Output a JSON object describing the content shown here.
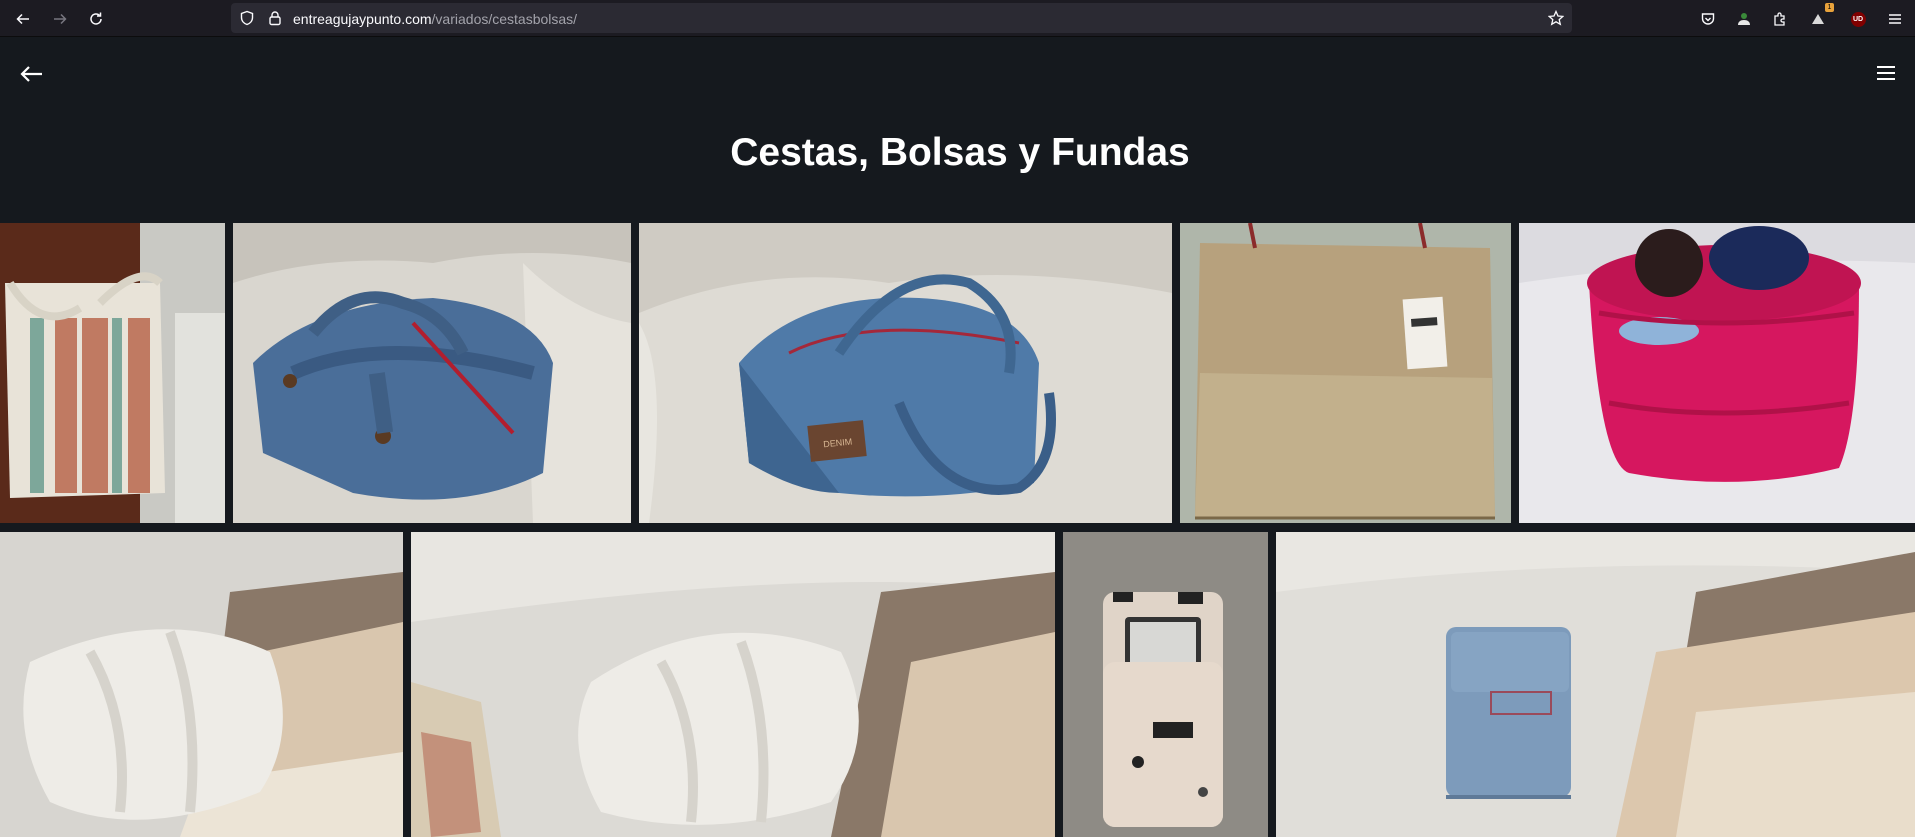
{
  "browser": {
    "url_domain": "entreagujaypunto.com",
    "url_path": "/variados/cestasbolsas/",
    "extension_badge": "1",
    "profile_badge": "UD"
  },
  "page": {
    "title": "Cestas, Bolsas y Fundas"
  },
  "gallery": {
    "items": [
      {
        "subject": "striped fabric tote bag hanging on door"
      },
      {
        "subject": "denim zipped bag with red zipper"
      },
      {
        "subject": "denim bag with handles and leather label"
      },
      {
        "subject": "jute burlap bag with tag"
      },
      {
        "subject": "pink crochet basket with yarn"
      },
      {
        "subject": "white cable-knit cushion on sofa"
      },
      {
        "subject": "white cable-knit cushion and floral cushion"
      },
      {
        "subject": "fabric e-reader case with dog print"
      },
      {
        "subject": "denim pouch next to knitted blanket"
      }
    ],
    "labels": {
      "denim_patch": "DENIM"
    }
  }
}
